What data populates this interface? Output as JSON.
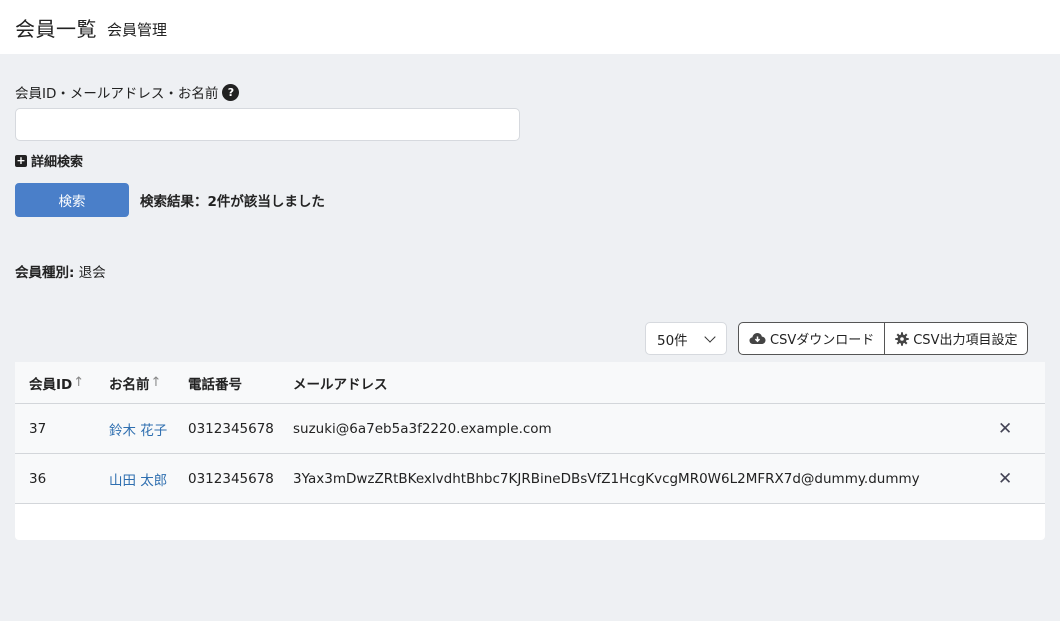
{
  "header": {
    "title": "会員一覧",
    "subtitle": "会員管理"
  },
  "search": {
    "label": "会員ID・メールアドレス・お名前",
    "help_icon": "?",
    "input_value": "",
    "input_placeholder": "",
    "advanced_label": "詳細検索",
    "button_label": "検索",
    "result_text": "検索結果：2件が該当しました"
  },
  "filter": {
    "member_type_label": "会員種別:",
    "member_type_value": "退会"
  },
  "toolbar": {
    "perpage_value": "50件",
    "csv_download_label": "CSVダウンロード",
    "csv_settings_label": "CSV出力項目設定"
  },
  "table": {
    "headers": {
      "id": "会員ID",
      "name": "お名前",
      "tel": "電話番号",
      "email": "メールアドレス",
      "sort_arrow": "↑"
    },
    "rows": [
      {
        "id": "37",
        "name": "鈴木 花子",
        "tel": "0312345678",
        "email": "suzuki@6a7eb5a3f2220.example.com",
        "delete": "✕"
      },
      {
        "id": "36",
        "name": "山田 太郎",
        "tel": "0312345678",
        "email": "3Yax3mDwzZRtBKexlvdhtBhbc7KJRBineDBsVfZ1HcgKvcgMR0W6L2MFRX7d@dummy.dummy",
        "delete": "✕"
      }
    ]
  },
  "colors": {
    "primary_button": "#4a7fc9",
    "link": "#2f6fb0",
    "background": "#eef0f3"
  },
  "icons": {
    "help": "help-icon",
    "advanced": "plus-square-icon",
    "csv_download": "cloud-download-icon",
    "csv_settings": "gear-icon",
    "perpage": "chevron-down-icon",
    "sort": "arrow-up-icon",
    "delete": "close-icon"
  }
}
